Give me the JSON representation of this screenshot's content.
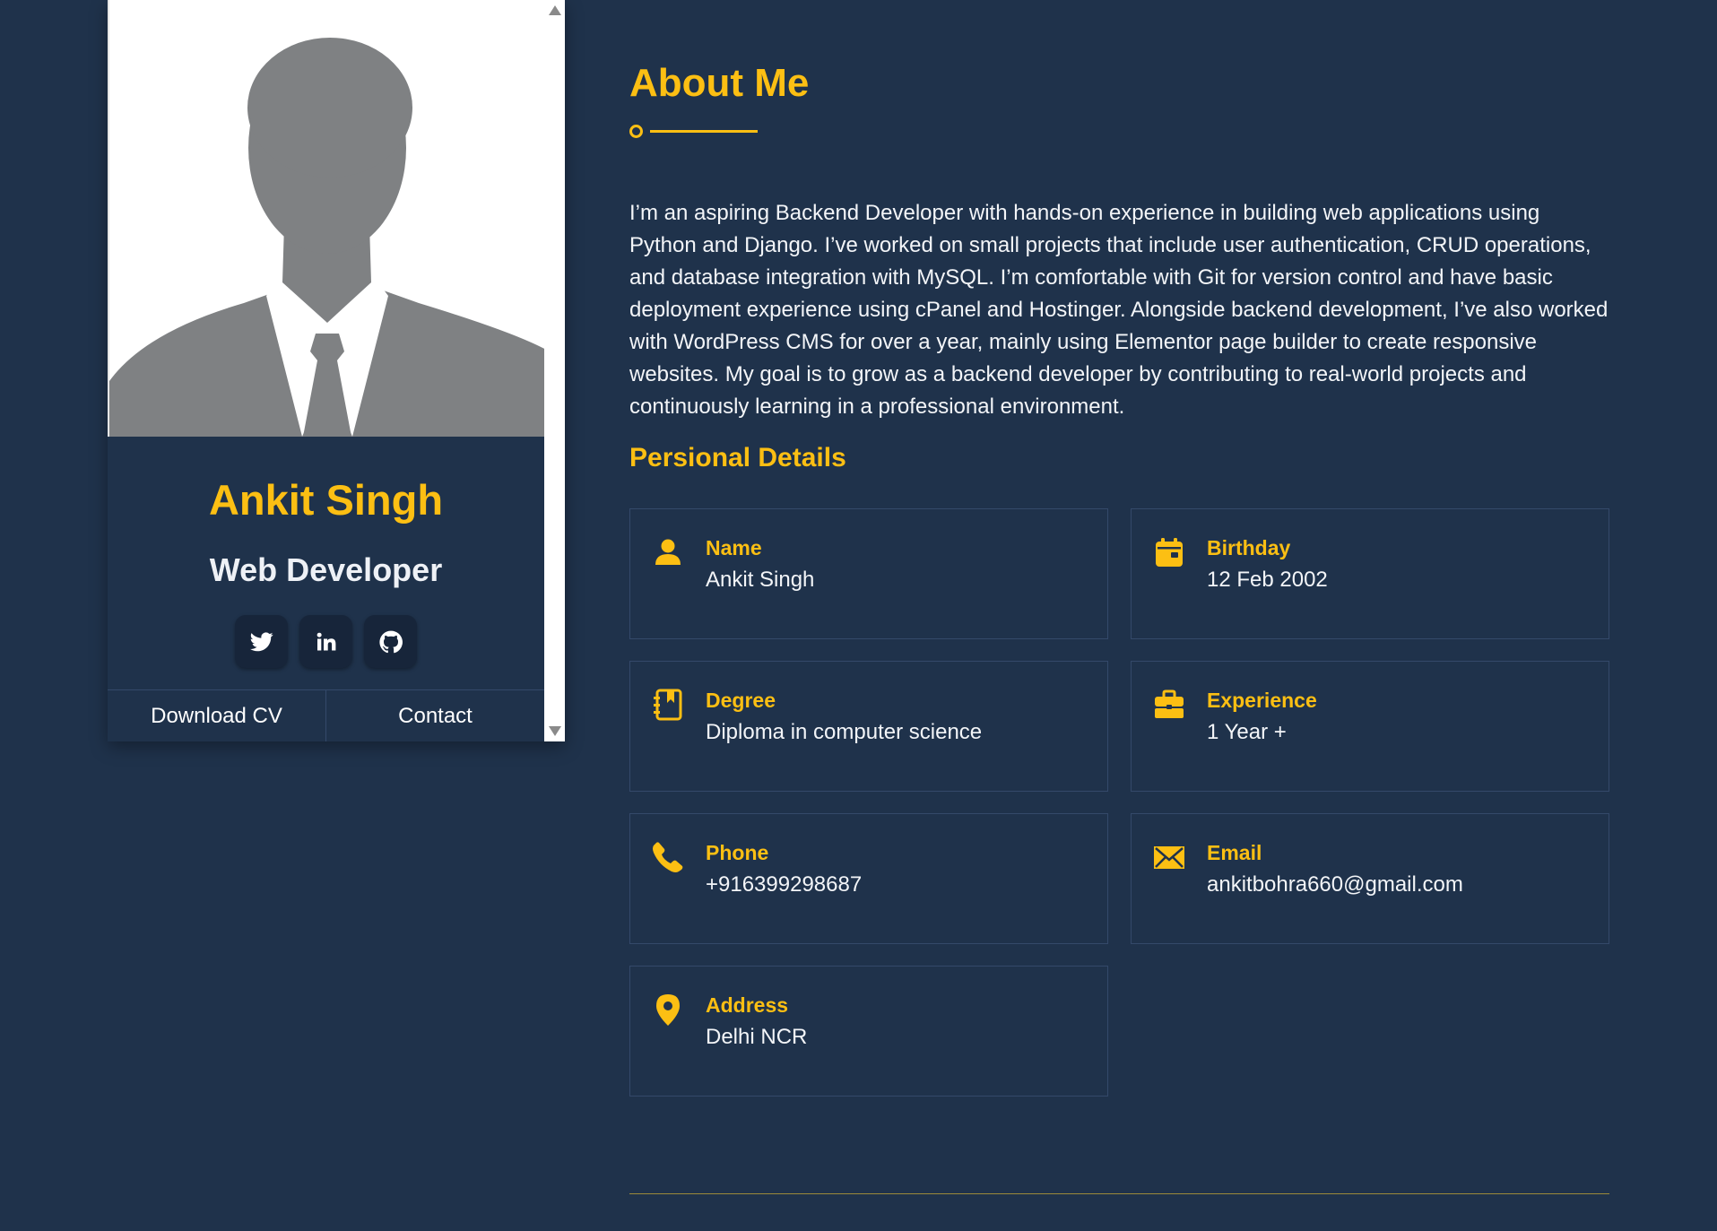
{
  "profile": {
    "name": "Ankit Singh",
    "role": "Web Developer",
    "socials": [
      {
        "icon": "twitter-icon"
      },
      {
        "icon": "linkedin-icon"
      },
      {
        "icon": "github-icon"
      }
    ],
    "actions": {
      "download_label": "Download CV",
      "contact_label": "Contact"
    }
  },
  "about": {
    "title": "About Me",
    "text": "I’m an aspiring Backend Developer with hands-on experience in building web applications using Python and Django. I’ve worked on small projects that include user authentication, CRUD operations, and database integration with MySQL. I’m comfortable with Git for version control and have basic deployment experience using cPanel and Hostinger. Alongside backend development, I’ve also worked with WordPress CMS for over a year, mainly using Elementor page builder to create responsive websites. My goal is to grow as a backend developer by contributing to real-world projects and continuously learning in a professional environment."
  },
  "details": {
    "title": "Persional Details",
    "items": [
      {
        "label": "Name",
        "value": "Ankit Singh",
        "icon": "user-icon"
      },
      {
        "label": "Birthday",
        "value": "12 Feb 2002",
        "icon": "calendar-icon"
      },
      {
        "label": "Degree",
        "value": "Diploma in computer science",
        "icon": "address-book-icon"
      },
      {
        "label": "Experience",
        "value": "1 Year +",
        "icon": "briefcase-icon"
      },
      {
        "label": "Phone",
        "value": "+916399298687",
        "icon": "phone-icon"
      },
      {
        "label": "Email",
        "value": "ankitbohra660@gmail.com",
        "icon": "envelope-icon"
      },
      {
        "label": "Address",
        "value": "Delhi NCR",
        "icon": "map-pin-icon"
      }
    ]
  },
  "colors": {
    "background": "#1f324b",
    "accent": "#fcbf13",
    "text": "#f3f5f8"
  }
}
